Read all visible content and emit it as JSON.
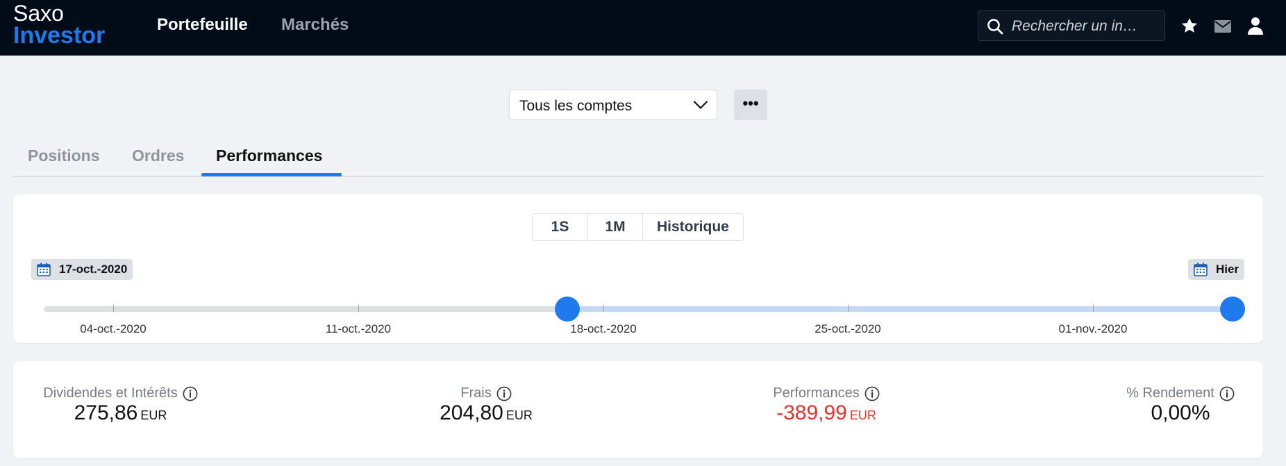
{
  "brand": {
    "line1": "Saxo",
    "line2": "Investor",
    "accent": "#1f7aec",
    "header_bg": "#020c18"
  },
  "nav": {
    "portfolio": "Portefeuille",
    "markets": "Marchés"
  },
  "search": {
    "placeholder": "Rechercher un in…"
  },
  "header_icons": [
    "star-icon",
    "mail-icon",
    "user-icon"
  ],
  "account": {
    "selected": "Tous les comptes",
    "more_icon": "ellipsis-icon",
    "more_label": "•••"
  },
  "tabs": [
    {
      "label": "Positions",
      "active": false
    },
    {
      "label": "Ordres",
      "active": false
    },
    {
      "label": "Performances",
      "active": true
    }
  ],
  "period": {
    "options": [
      "1S",
      "1M",
      "Historique"
    ]
  },
  "range": {
    "start_label": "17-oct.-2020",
    "end_label": "Hier",
    "ticks": [
      "04-oct.-2020",
      "11-oct.-2020",
      "18-oct.-2020",
      "25-oct.-2020",
      "01-nov.-2020"
    ]
  },
  "metrics": [
    {
      "label": "Dividendes et Intérêts",
      "value": "275,86",
      "unit": "EUR"
    },
    {
      "label": "Frais",
      "value": "204,80",
      "unit": "EUR"
    },
    {
      "label": "Performances",
      "value": "-389,99",
      "unit": "EUR",
      "negative_color": "#e0342c"
    },
    {
      "label": "% Rendement",
      "value": "0,00%",
      "unit": ""
    }
  ]
}
